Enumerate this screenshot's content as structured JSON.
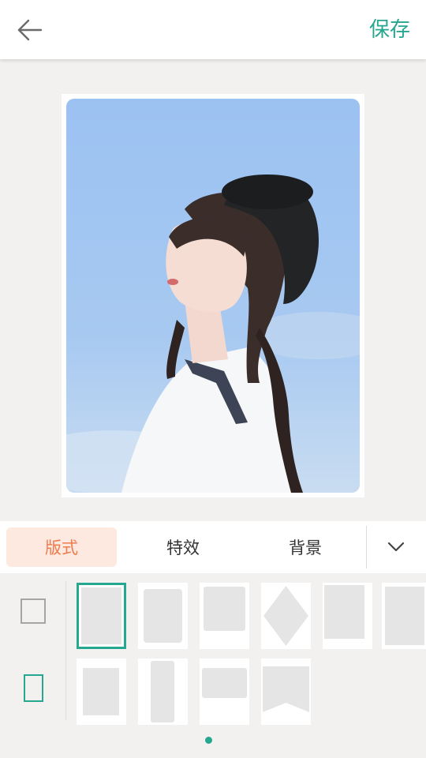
{
  "header": {
    "back_icon": "arrow-left-icon",
    "save_label": "保存",
    "accent_color": "#26a78f"
  },
  "tabs": [
    {
      "label": "版式",
      "active": true
    },
    {
      "label": "特效",
      "active": false
    },
    {
      "label": "背景",
      "active": false
    }
  ],
  "collapse_icon": "chevron-down-icon",
  "aspect_ratios": [
    {
      "icon": "square-ratio-icon",
      "selected": false
    },
    {
      "icon": "portrait-ratio-icon",
      "selected": true
    }
  ],
  "layouts": {
    "selected_index": 0,
    "count": 10
  },
  "pagination": {
    "current": 1,
    "total": 1
  }
}
